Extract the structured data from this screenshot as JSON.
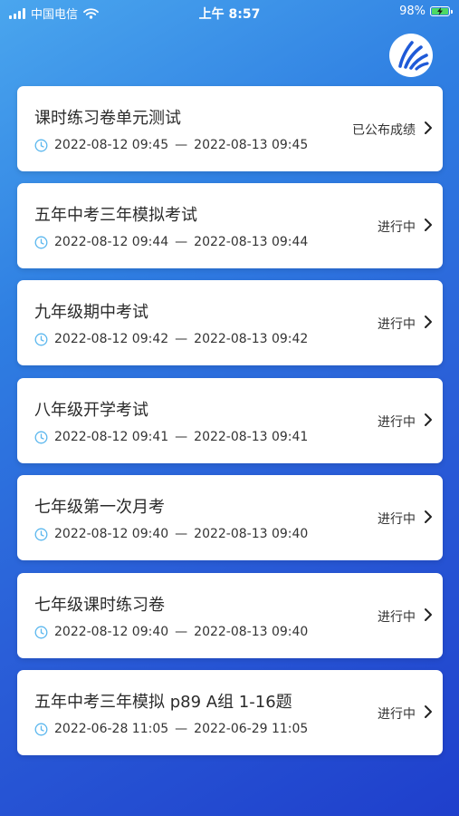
{
  "status_bar": {
    "carrier": "中国电信",
    "time": "上午 8:57",
    "battery_percent": "98%",
    "battery_level": 0.98,
    "wifi_icon": "wifi-icon",
    "charging_icon": "bolt-icon"
  },
  "colors": {
    "background_top": "#4aa6ee",
    "background_bottom": "#1f3fcc",
    "card": "#ffffff",
    "clock_icon": "#5bb7ee",
    "battery_fill": "#4cd964"
  },
  "exams": [
    {
      "title": "课时练习卷单元测试",
      "start": "2022-08-12 09:45",
      "separator": "—",
      "end": "2022-08-13 09:45",
      "status": "已公布成绩"
    },
    {
      "title": "五年中考三年模拟考试",
      "start": "2022-08-12 09:44",
      "separator": "—",
      "end": "2022-08-13 09:44",
      "status": "进行中"
    },
    {
      "title": "九年级期中考试",
      "start": "2022-08-12 09:42",
      "separator": "—",
      "end": "2022-08-13 09:42",
      "status": "进行中"
    },
    {
      "title": "八年级开学考试",
      "start": "2022-08-12 09:41",
      "separator": "—",
      "end": "2022-08-13 09:41",
      "status": "进行中"
    },
    {
      "title": "七年级第一次月考",
      "start": "2022-08-12 09:40",
      "separator": "—",
      "end": "2022-08-13 09:40",
      "status": "进行中"
    },
    {
      "title": "七年级课时练习卷",
      "start": "2022-08-12 09:40",
      "separator": "—",
      "end": "2022-08-13 09:40",
      "status": "进行中"
    },
    {
      "title": "五年中考三年模拟 p89 A组 1-16题",
      "start": "2022-06-28 11:05",
      "separator": "—",
      "end": "2022-06-29 11:05",
      "status": "进行中"
    }
  ]
}
